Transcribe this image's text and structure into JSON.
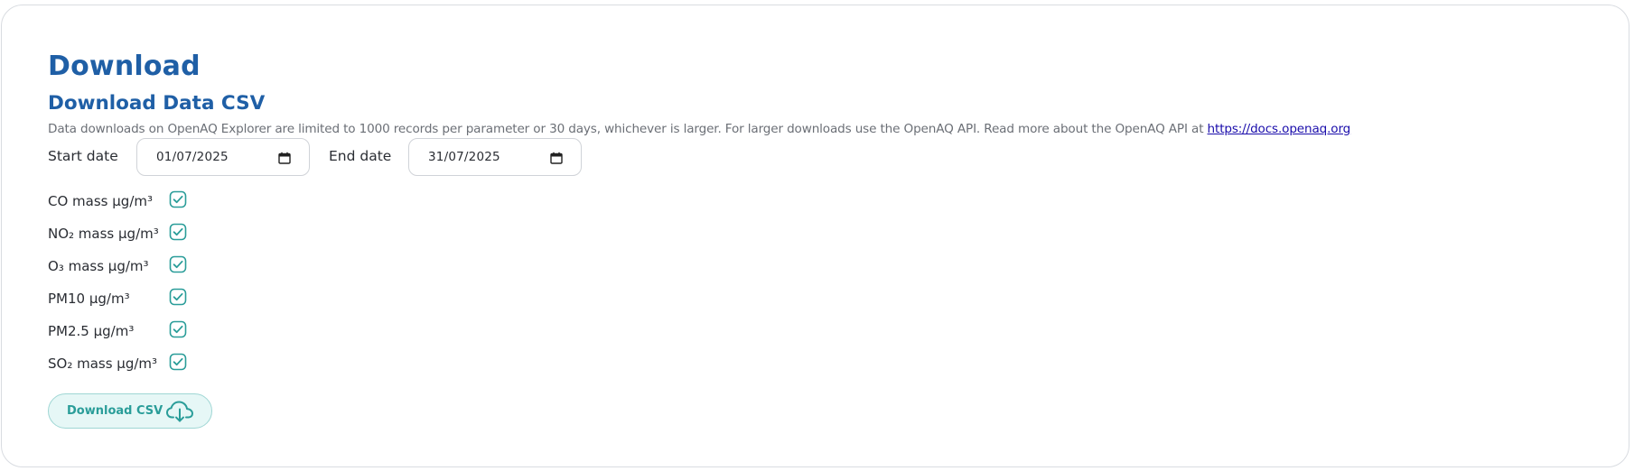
{
  "header": {
    "title": "Download",
    "subtitle": "Download Data CSV",
    "description": "Data downloads on OpenAQ Explorer are limited to 1000 records per parameter or 30 days, whichever is larger. For larger downloads use the OpenAQ API. Read more about the OpenAQ API at ",
    "link_text": "https://docs.openaq.org"
  },
  "dates": {
    "start_label": "Start date",
    "start_value": "01/07/2025",
    "end_label": "End date",
    "end_value": "31/07/2025"
  },
  "parameters": [
    {
      "label": "CO mass µg/m³",
      "checked": true
    },
    {
      "label": "NO₂ mass µg/m³",
      "checked": true
    },
    {
      "label": "O₃ mass µg/m³",
      "checked": true
    },
    {
      "label": "PM10 µg/m³",
      "checked": true
    },
    {
      "label": "PM2.5 µg/m³",
      "checked": true
    },
    {
      "label": "SO₂ mass µg/m³",
      "checked": true
    }
  ],
  "download_button": {
    "label": "Download CSV",
    "icon": "cloud-download-icon"
  },
  "colors": {
    "heading": "#1f5fa6",
    "accent": "#2a9d99",
    "button_bg": "#e6f7f6",
    "link": "#1a0dab"
  }
}
